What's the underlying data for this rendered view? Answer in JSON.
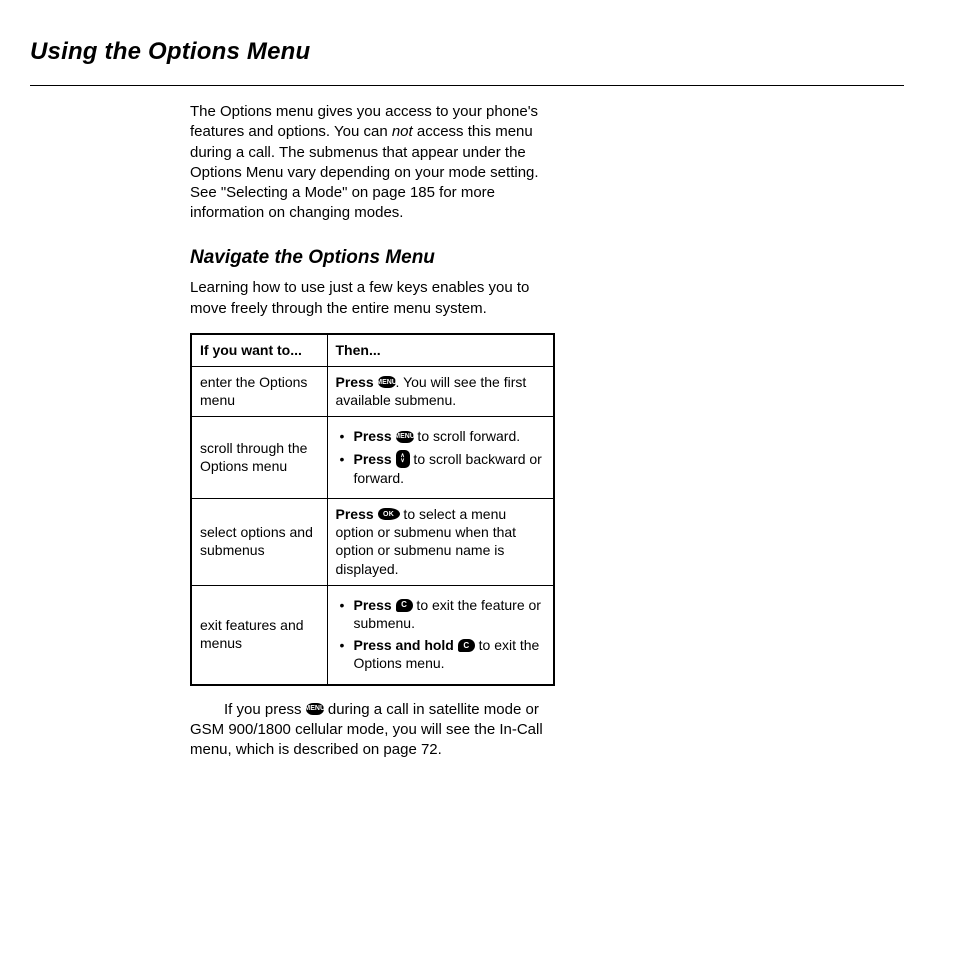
{
  "heading": "Using the Options Menu",
  "intro": {
    "pre": "The Options menu gives you access to your phone's features and options. You can ",
    "em": "not",
    "post": " access this menu during a call. The submenus that appear under the Options Menu vary depending on your mode setting. See \"Selecting a Mode\" on page 185 for more information on changing modes."
  },
  "subheading": "Navigate the Options Menu",
  "lead": "Learning how to use just a few keys enables you to move freely through the entire menu system.",
  "table": {
    "h1": "If you want to...",
    "h2": "Then...",
    "rows": [
      {
        "want": "enter the Options menu",
        "then": {
          "press": "Press",
          "key": "MENU",
          "after": ". You will see the first available submenu."
        }
      },
      {
        "want": "scroll through the Options menu",
        "then_list": [
          {
            "press": "Press",
            "key": "MENU",
            "after": " to scroll forward."
          },
          {
            "press": "Press",
            "key": "ARROW",
            "after": " to scroll backward or forward."
          }
        ]
      },
      {
        "want": "select options and submenus",
        "then": {
          "press": "Press",
          "key": "OK",
          "after": " to select a menu option or submenu when that option or submenu name is displayed."
        }
      },
      {
        "want": "exit features and menus",
        "then_list": [
          {
            "press": "Press",
            "key": "C",
            "after": " to exit the feature or submenu."
          },
          {
            "press": "Press and hold",
            "key": "C",
            "after": " to exit the Options menu."
          }
        ]
      }
    ]
  },
  "footnote": {
    "pre": "If you press ",
    "key": "MENU",
    "mid": " during",
    "post": " a call in satellite mode or GSM 900/1800 cellular mode, you will see the In-Call menu, which is described on page 72."
  },
  "keys": {
    "MENU": "MENU",
    "OK": "OK",
    "C": "C"
  }
}
